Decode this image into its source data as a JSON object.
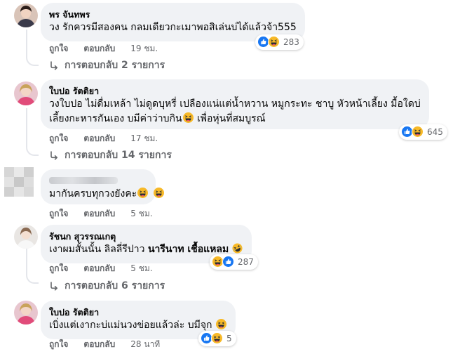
{
  "comments": [
    {
      "author": "พร จันทพร",
      "text": "วง รักควรมีสองคน กลมเดียวกะเมาพอสิเล่นบ่ได้แล้วจ้า555",
      "like_label": "ถูกใจ",
      "reply_label": "ตอบกลับ",
      "time": "19 ชม.",
      "reaction_count": "283",
      "replies_label": "การตอบกลับ 2 รายการ"
    },
    {
      "author": "ใบปอ รัตติยา",
      "text_line1": "วงใบปอ ไม่ดื่มเหล้า ไม่ดูดบุหรี่ เปลืองแน่แต่น้ำหวาน หมูกระทะ ชาบู หัวหน้าเลี้ยง มื้อใดบ่",
      "text_line2a": "เลี้ยงกะหารกันเอง บมีค่าว่าบกิน",
      "text_line2b": " เพื่อหุ่นที่สมบูรณ์",
      "like_label": "ถูกใจ",
      "reply_label": "ตอบกลับ",
      "time": "17 ชม.",
      "reaction_count": "645",
      "replies_label": "การตอบกลับ 14 รายการ"
    },
    {
      "author": "",
      "text": "มากันครบทุกวงยังคะ",
      "like_label": "ถูกใจ",
      "reply_label": "ตอบกลับ",
      "time": "5 ชม."
    },
    {
      "author": "รัชนก สุวรรณเกตุ",
      "text_plain": "เงาผมสั้นนั้น ลิลลี่รีปาว ",
      "text_bold": "นารีนาท เชื้อแหลม",
      "like_label": "ถูกใจ",
      "reply_label": "ตอบกลับ",
      "time": "5 ชม.",
      "reaction_count": "287",
      "replies_label": "การตอบกลับ 6 รายการ"
    },
    {
      "author": "ใบปอ รัตติยา",
      "text": "เบิ่งแต่เงากะบ่แม่นวงข่อยแล้วล่ะ บมีจุก",
      "like_label": "ถูกใจ",
      "reply_label": "ตอบกลับ",
      "time": "28 นาที",
      "reaction_count": "5"
    }
  ],
  "colors": {
    "bubble": "#f0f2f5",
    "meta": "#65676b",
    "like_blue": "#1877f2",
    "haha_yellow": "#f7b928"
  },
  "icons": [
    "like-reaction-icon",
    "haha-reaction-icon",
    "reply-arrow-icon",
    "laughing-emoji-icon",
    "rolling-laughing-emoji-icon"
  ]
}
